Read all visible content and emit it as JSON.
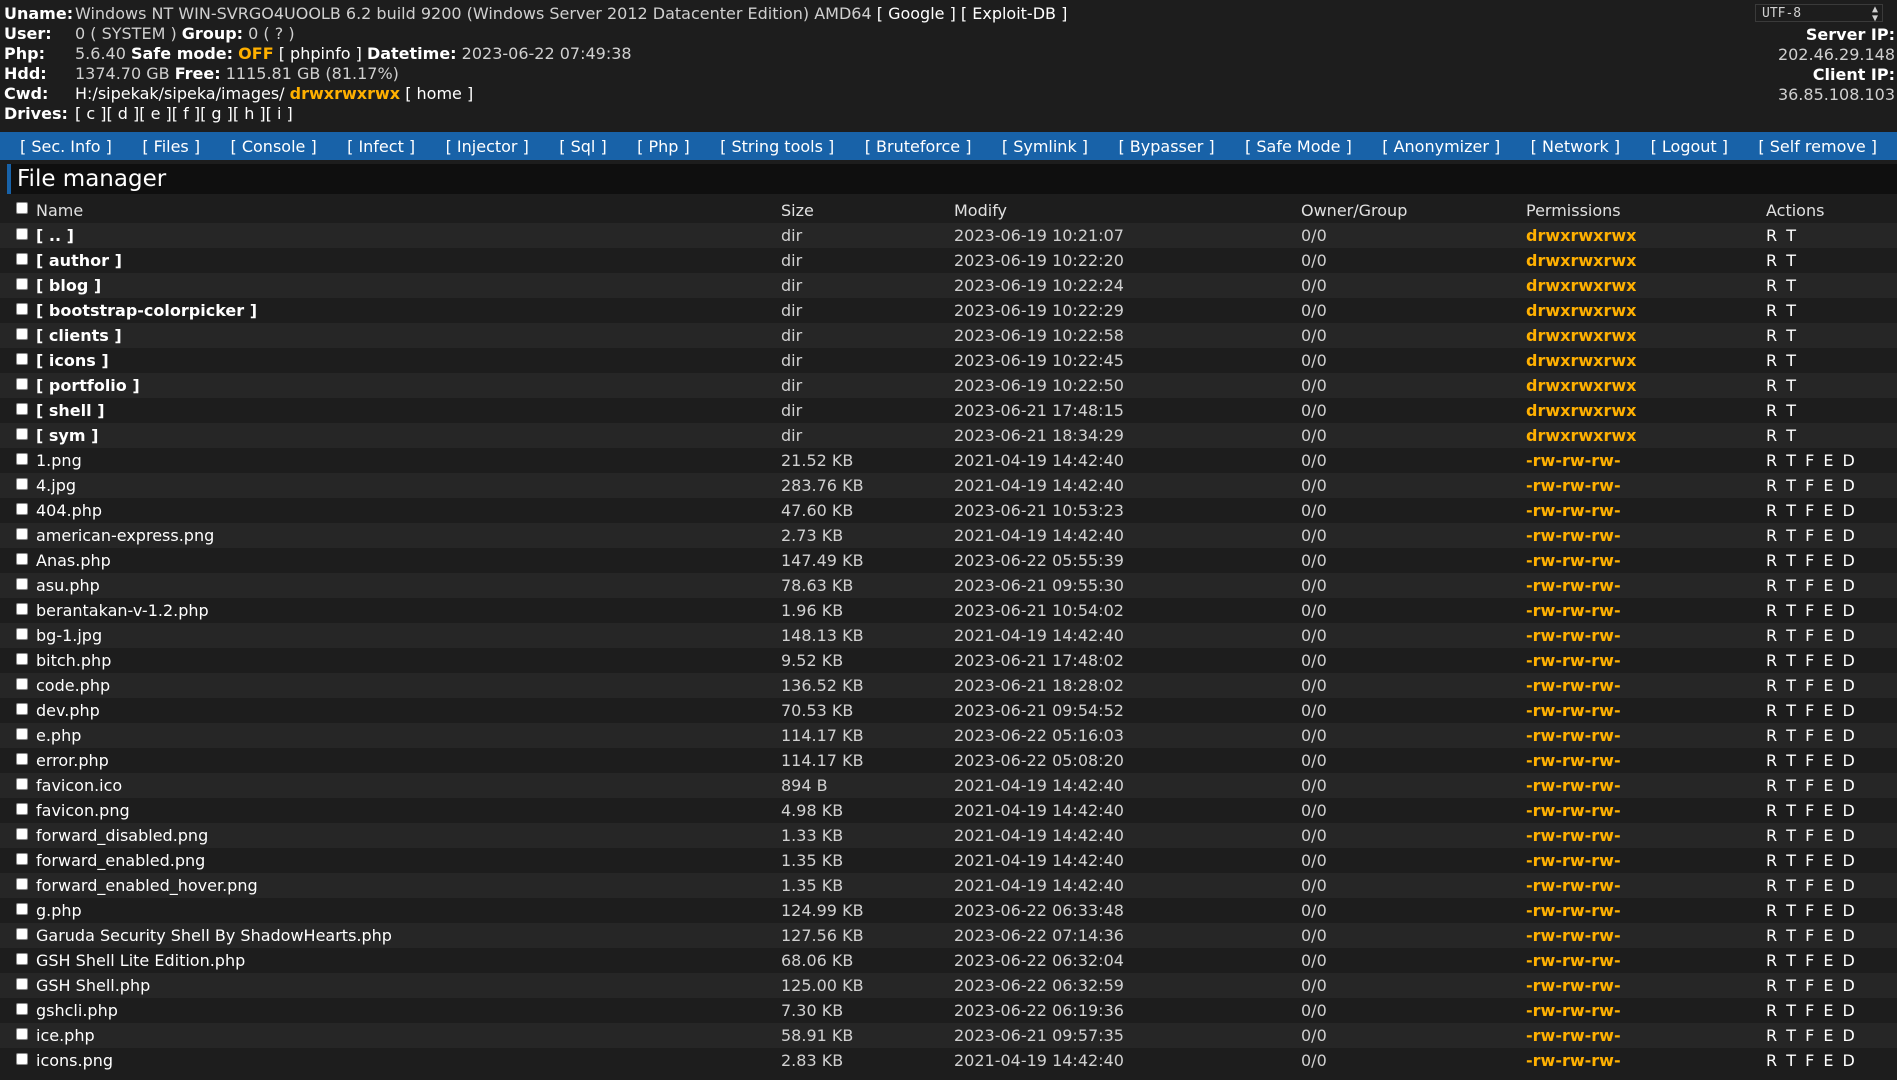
{
  "info": {
    "uname_label": "Uname:",
    "uname_value": "Windows NT WIN-SVRGO4UOOLB 6.2 build 9200 (Windows Server 2012 Datacenter Edition) AMD64",
    "google_link": "[ Google ]",
    "exploitdb_link": "[ Exploit-DB ]",
    "user_label": "User:",
    "user_value": "0 ( SYSTEM )",
    "group_label": "Group:",
    "group_value": "0 ( ? )",
    "php_label": "Php:",
    "php_value": "5.6.40",
    "safemode_label": "Safe mode:",
    "safemode_value": "OFF",
    "phpinfo_link": "[ phpinfo ]",
    "datetime_label": "Datetime:",
    "datetime_value": "2023-06-22 07:49:38",
    "hdd_label": "Hdd:",
    "hdd_value": "1374.70 GB",
    "free_label": "Free:",
    "free_value": "1115.81 GB (81.17%)",
    "cwd_label": "Cwd:",
    "cwd_value": "H:/sipekak/sipeka/images/",
    "cwd_perm": "drwxrwxrwx",
    "home_link": "[ home ]",
    "drives_label": "Drives:",
    "drives": [
      "[ c ]",
      "[ d ]",
      "[ e ]",
      "[ f ]",
      "[ g ]",
      "[ h ]",
      "[ i ]"
    ],
    "charset": "UTF-8",
    "server_ip_label": "Server IP:",
    "server_ip": "202.46.29.148",
    "client_ip_label": "Client IP:",
    "client_ip": "36.85.108.103"
  },
  "menu": [
    "[ Sec. Info ]",
    "[ Files ]",
    "[ Console ]",
    "[ Infect ]",
    "[ Injector ]",
    "[ Sql ]",
    "[ Php ]",
    "[ String tools ]",
    "[ Bruteforce ]",
    "[ Symlink ]",
    "[ Bypasser ]",
    "[ Safe Mode ]",
    "[ Anonymizer ]",
    "[ Network ]",
    "[ Logout ]",
    "[ Self remove ]"
  ],
  "file_manager": {
    "title": "File manager",
    "columns": [
      "Name",
      "Size",
      "Modify",
      "Owner/Group",
      "Permissions",
      "Actions"
    ],
    "rows": [
      {
        "name": "[ .. ]",
        "size": "dir",
        "modify": "2023-06-19 10:21:07",
        "owner": "0/0",
        "perm": "drwxrwxrwx",
        "actions": "R T",
        "dir": true
      },
      {
        "name": "[ author ]",
        "size": "dir",
        "modify": "2023-06-19 10:22:20",
        "owner": "0/0",
        "perm": "drwxrwxrwx",
        "actions": "R T",
        "dir": true
      },
      {
        "name": "[ blog ]",
        "size": "dir",
        "modify": "2023-06-19 10:22:24",
        "owner": "0/0",
        "perm": "drwxrwxrwx",
        "actions": "R T",
        "dir": true
      },
      {
        "name": "[ bootstrap-colorpicker ]",
        "size": "dir",
        "modify": "2023-06-19 10:22:29",
        "owner": "0/0",
        "perm": "drwxrwxrwx",
        "actions": "R T",
        "dir": true
      },
      {
        "name": "[ clients ]",
        "size": "dir",
        "modify": "2023-06-19 10:22:58",
        "owner": "0/0",
        "perm": "drwxrwxrwx",
        "actions": "R T",
        "dir": true
      },
      {
        "name": "[ icons ]",
        "size": "dir",
        "modify": "2023-06-19 10:22:45",
        "owner": "0/0",
        "perm": "drwxrwxrwx",
        "actions": "R T",
        "dir": true
      },
      {
        "name": "[ portfolio ]",
        "size": "dir",
        "modify": "2023-06-19 10:22:50",
        "owner": "0/0",
        "perm": "drwxrwxrwx",
        "actions": "R T",
        "dir": true
      },
      {
        "name": "[ shell ]",
        "size": "dir",
        "modify": "2023-06-21 17:48:15",
        "owner": "0/0",
        "perm": "drwxrwxrwx",
        "actions": "R T",
        "dir": true
      },
      {
        "name": "[ sym ]",
        "size": "dir",
        "modify": "2023-06-21 18:34:29",
        "owner": "0/0",
        "perm": "drwxrwxrwx",
        "actions": "R T",
        "dir": true
      },
      {
        "name": "1.png",
        "size": "21.52 KB",
        "modify": "2021-04-19 14:42:40",
        "owner": "0/0",
        "perm": "-rw-rw-rw-",
        "actions": "R T F E D",
        "dir": false
      },
      {
        "name": "4.jpg",
        "size": "283.76 KB",
        "modify": "2021-04-19 14:42:40",
        "owner": "0/0",
        "perm": "-rw-rw-rw-",
        "actions": "R T F E D",
        "dir": false
      },
      {
        "name": "404.php",
        "size": "47.60 KB",
        "modify": "2023-06-21 10:53:23",
        "owner": "0/0",
        "perm": "-rw-rw-rw-",
        "actions": "R T F E D",
        "dir": false
      },
      {
        "name": "american-express.png",
        "size": "2.73 KB",
        "modify": "2021-04-19 14:42:40",
        "owner": "0/0",
        "perm": "-rw-rw-rw-",
        "actions": "R T F E D",
        "dir": false
      },
      {
        "name": "Anas.php",
        "size": "147.49 KB",
        "modify": "2023-06-22 05:55:39",
        "owner": "0/0",
        "perm": "-rw-rw-rw-",
        "actions": "R T F E D",
        "dir": false
      },
      {
        "name": "asu.php",
        "size": "78.63 KB",
        "modify": "2023-06-21 09:55:30",
        "owner": "0/0",
        "perm": "-rw-rw-rw-",
        "actions": "R T F E D",
        "dir": false
      },
      {
        "name": "berantakan-v-1.2.php",
        "size": "1.96 KB",
        "modify": "2023-06-21 10:54:02",
        "owner": "0/0",
        "perm": "-rw-rw-rw-",
        "actions": "R T F E D",
        "dir": false
      },
      {
        "name": "bg-1.jpg",
        "size": "148.13 KB",
        "modify": "2021-04-19 14:42:40",
        "owner": "0/0",
        "perm": "-rw-rw-rw-",
        "actions": "R T F E D",
        "dir": false
      },
      {
        "name": "bitch.php",
        "size": "9.52 KB",
        "modify": "2023-06-21 17:48:02",
        "owner": "0/0",
        "perm": "-rw-rw-rw-",
        "actions": "R T F E D",
        "dir": false
      },
      {
        "name": "code.php",
        "size": "136.52 KB",
        "modify": "2023-06-21 18:28:02",
        "owner": "0/0",
        "perm": "-rw-rw-rw-",
        "actions": "R T F E D",
        "dir": false
      },
      {
        "name": "dev.php",
        "size": "70.53 KB",
        "modify": "2023-06-21 09:54:52",
        "owner": "0/0",
        "perm": "-rw-rw-rw-",
        "actions": "R T F E D",
        "dir": false
      },
      {
        "name": "e.php",
        "size": "114.17 KB",
        "modify": "2023-06-22 05:16:03",
        "owner": "0/0",
        "perm": "-rw-rw-rw-",
        "actions": "R T F E D",
        "dir": false
      },
      {
        "name": "error.php",
        "size": "114.17 KB",
        "modify": "2023-06-22 05:08:20",
        "owner": "0/0",
        "perm": "-rw-rw-rw-",
        "actions": "R T F E D",
        "dir": false
      },
      {
        "name": "favicon.ico",
        "size": "894 B",
        "modify": "2021-04-19 14:42:40",
        "owner": "0/0",
        "perm": "-rw-rw-rw-",
        "actions": "R T F E D",
        "dir": false
      },
      {
        "name": "favicon.png",
        "size": "4.98 KB",
        "modify": "2021-04-19 14:42:40",
        "owner": "0/0",
        "perm": "-rw-rw-rw-",
        "actions": "R T F E D",
        "dir": false
      },
      {
        "name": "forward_disabled.png",
        "size": "1.33 KB",
        "modify": "2021-04-19 14:42:40",
        "owner": "0/0",
        "perm": "-rw-rw-rw-",
        "actions": "R T F E D",
        "dir": false
      },
      {
        "name": "forward_enabled.png",
        "size": "1.35 KB",
        "modify": "2021-04-19 14:42:40",
        "owner": "0/0",
        "perm": "-rw-rw-rw-",
        "actions": "R T F E D",
        "dir": false
      },
      {
        "name": "forward_enabled_hover.png",
        "size": "1.35 KB",
        "modify": "2021-04-19 14:42:40",
        "owner": "0/0",
        "perm": "-rw-rw-rw-",
        "actions": "R T F E D",
        "dir": false
      },
      {
        "name": "g.php",
        "size": "124.99 KB",
        "modify": "2023-06-22 06:33:48",
        "owner": "0/0",
        "perm": "-rw-rw-rw-",
        "actions": "R T F E D",
        "dir": false
      },
      {
        "name": "Garuda Security Shell By ShadowHearts.php",
        "size": "127.56 KB",
        "modify": "2023-06-22 07:14:36",
        "owner": "0/0",
        "perm": "-rw-rw-rw-",
        "actions": "R T F E D",
        "dir": false
      },
      {
        "name": "GSH Shell Lite Edition.php",
        "size": "68.06 KB",
        "modify": "2023-06-22 06:32:04",
        "owner": "0/0",
        "perm": "-rw-rw-rw-",
        "actions": "R T F E D",
        "dir": false
      },
      {
        "name": "GSH Shell.php",
        "size": "125.00 KB",
        "modify": "2023-06-22 06:32:59",
        "owner": "0/0",
        "perm": "-rw-rw-rw-",
        "actions": "R T F E D",
        "dir": false
      },
      {
        "name": "gshcli.php",
        "size": "7.30 KB",
        "modify": "2023-06-22 06:19:36",
        "owner": "0/0",
        "perm": "-rw-rw-rw-",
        "actions": "R T F E D",
        "dir": false
      },
      {
        "name": "ice.php",
        "size": "58.91 KB",
        "modify": "2023-06-21 09:57:35",
        "owner": "0/0",
        "perm": "-rw-rw-rw-",
        "actions": "R T F E D",
        "dir": false
      },
      {
        "name": "icons.png",
        "size": "2.83 KB",
        "modify": "2021-04-19 14:42:40",
        "owner": "0/0",
        "perm": "-rw-rw-rw-",
        "actions": "R T F E D",
        "dir": false
      }
    ]
  },
  "colors": {
    "background": "#1d1d1d",
    "menu_bar": "#1862a8",
    "permission": "#ffb000",
    "row_alt": "#262626"
  }
}
